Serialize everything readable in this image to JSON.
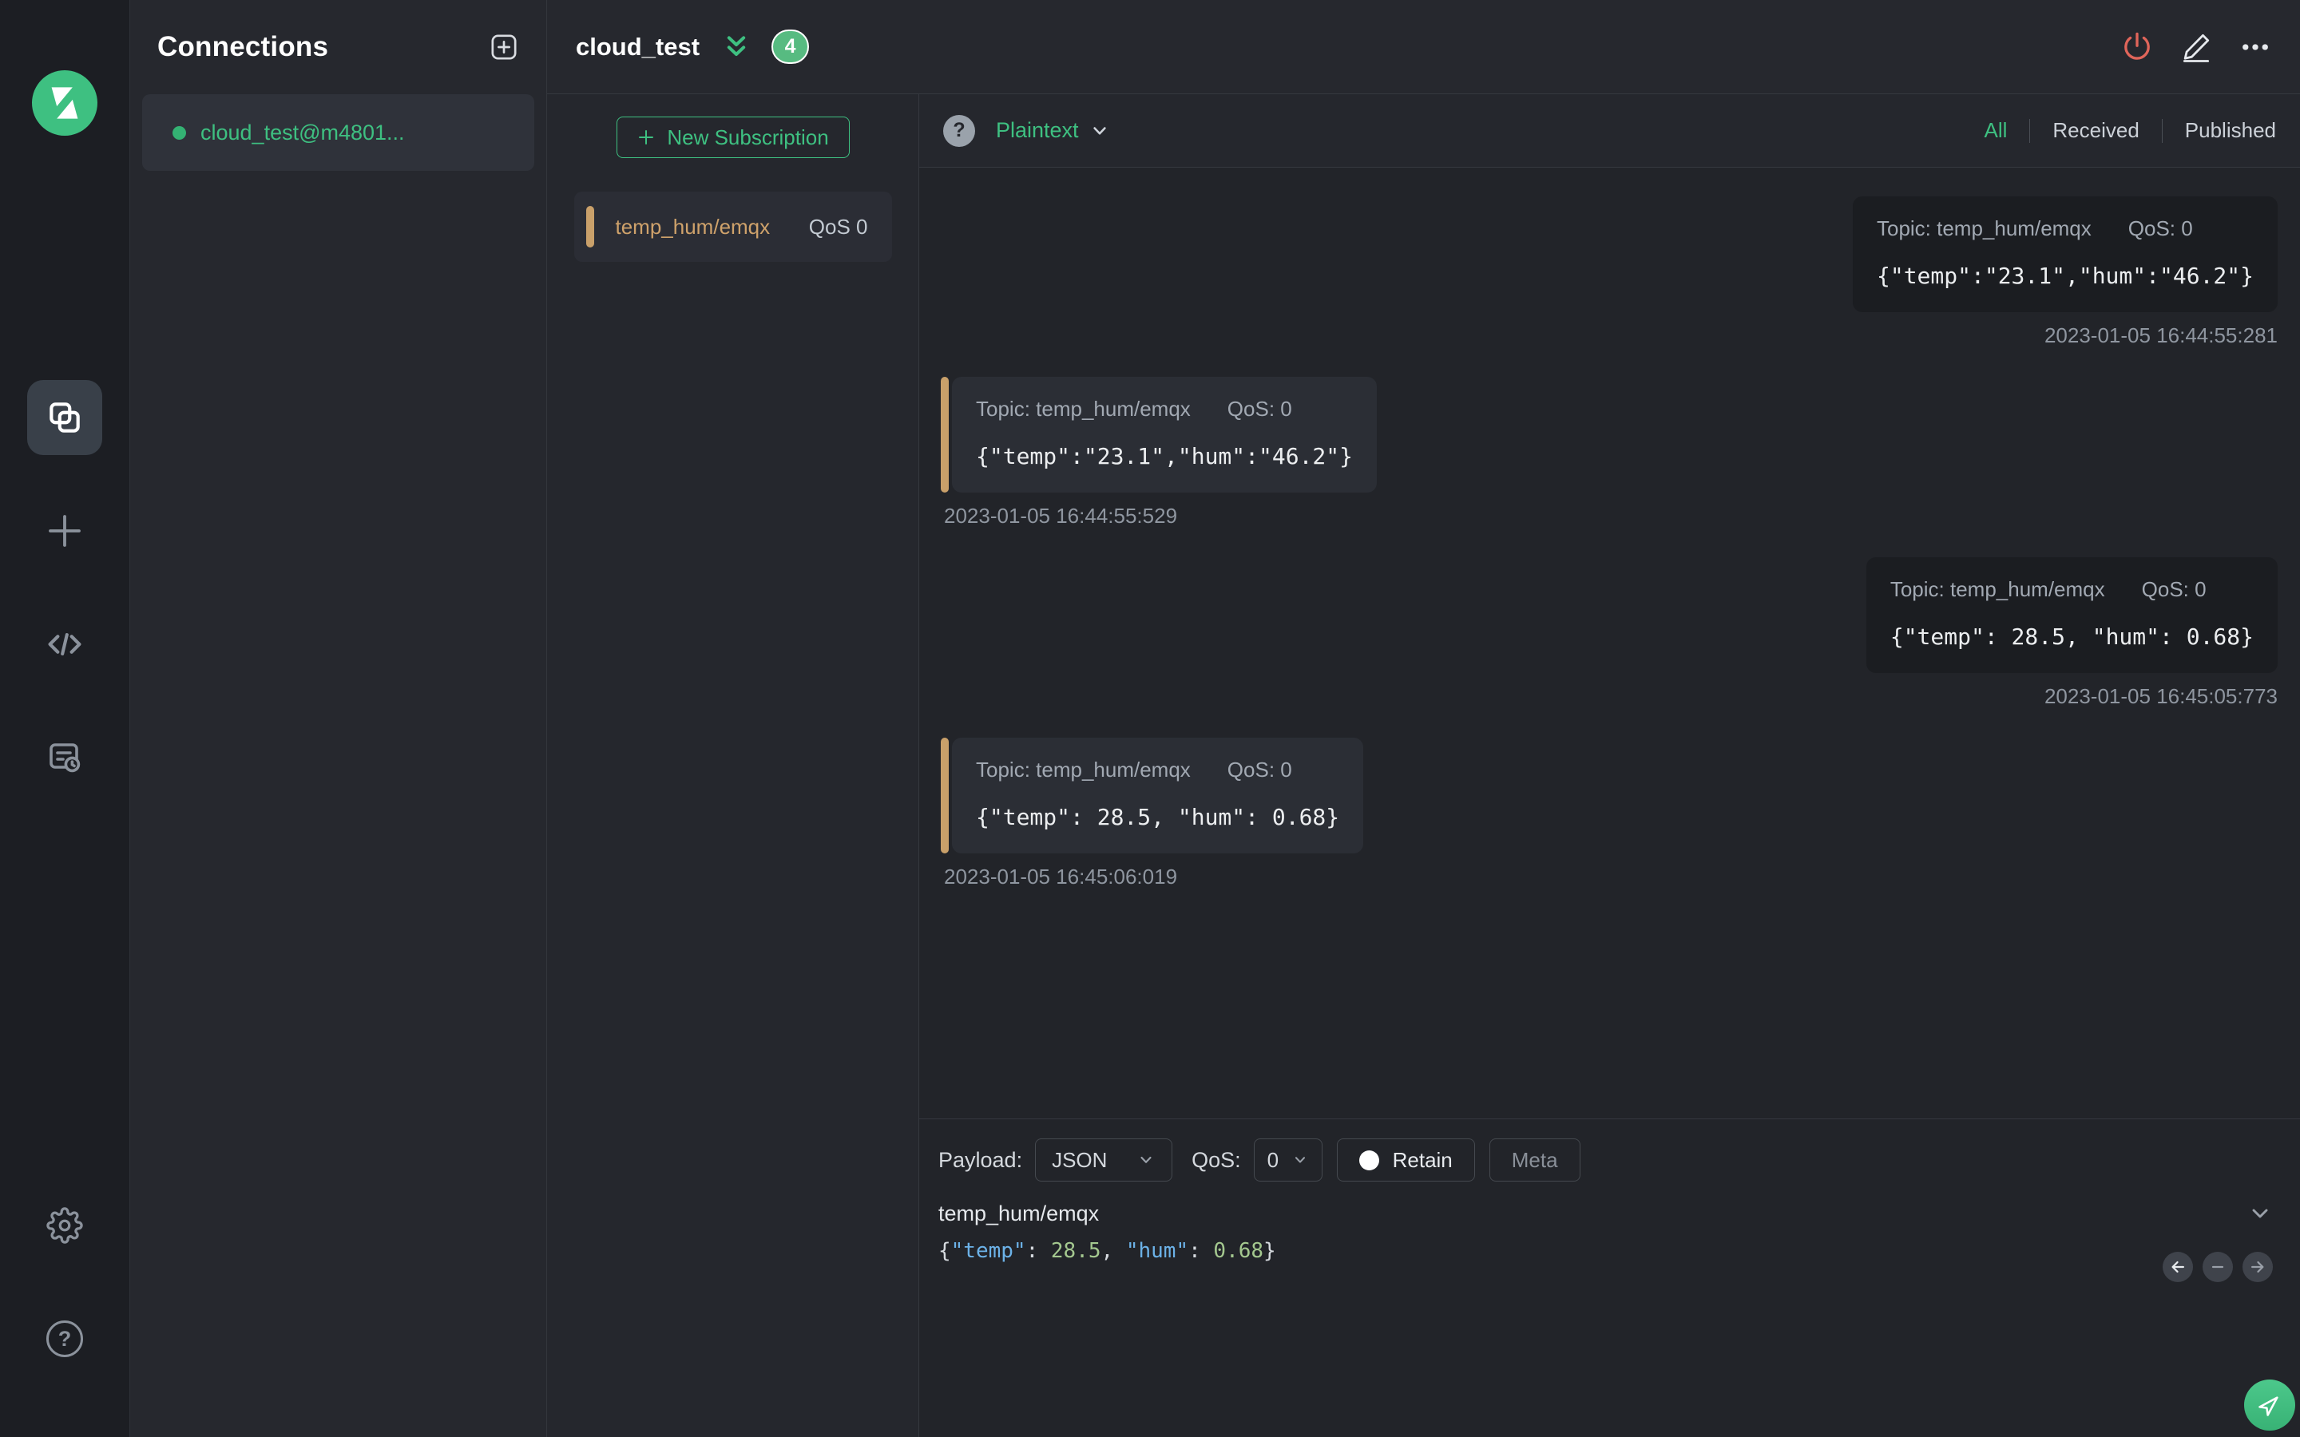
{
  "colors": {
    "accent": "#3ec081",
    "topic_accent": "#c9a06a",
    "power_icon": "#e0655a",
    "badge_bg": "#57bb81",
    "connection_status": "#34b273",
    "syntax_key": "#6cb2e8",
    "syntax_number": "#a4c88f"
  },
  "sidebar": {
    "title": "Connections",
    "connection_name": "cloud_test@m4801..."
  },
  "topbar": {
    "connection_name": "cloud_test",
    "badge_count": "4"
  },
  "subscriptions": {
    "new_button_label": "New Subscription",
    "items": [
      {
        "topic": "temp_hum/emqx",
        "qos": "QoS 0"
      }
    ]
  },
  "messages_header": {
    "help_glyph": "?",
    "format": "Plaintext",
    "tabs": [
      {
        "label": "All",
        "active": true
      },
      {
        "label": "Received",
        "active": false
      },
      {
        "label": "Published",
        "active": false
      }
    ]
  },
  "messages": [
    {
      "direction": "published",
      "topic_label": "Topic: temp_hum/emqx",
      "qos_label": "QoS: 0",
      "payload": "{\"temp\":\"23.1\",\"hum\":\"46.2\"}",
      "timestamp": "2023-01-05 16:44:55:281"
    },
    {
      "direction": "received",
      "topic_label": "Topic: temp_hum/emqx",
      "qos_label": "QoS: 0",
      "payload": "{\"temp\":\"23.1\",\"hum\":\"46.2\"}",
      "timestamp": "2023-01-05 16:44:55:529"
    },
    {
      "direction": "published",
      "topic_label": "Topic: temp_hum/emqx",
      "qos_label": "QoS: 0",
      "payload": "{\"temp\": 28.5, \"hum\": 0.68}",
      "timestamp": "2023-01-05 16:45:05:773"
    },
    {
      "direction": "received",
      "topic_label": "Topic: temp_hum/emqx",
      "qos_label": "QoS: 0",
      "payload": "{\"temp\": 28.5, \"hum\": 0.68}",
      "timestamp": "2023-01-05 16:45:06:019"
    }
  ],
  "publish": {
    "payload_label": "Payload:",
    "payload_format": "JSON",
    "qos_label": "QoS:",
    "qos_value": "0",
    "retain_label": "Retain",
    "meta_label": "Meta",
    "topic_value": "temp_hum/emqx",
    "payload_segments": [
      {
        "text": "{",
        "type": "punct"
      },
      {
        "text": "\"temp\"",
        "type": "key"
      },
      {
        "text": ": ",
        "type": "punct"
      },
      {
        "text": "28.5",
        "type": "number"
      },
      {
        "text": ", ",
        "type": "punct"
      },
      {
        "text": "\"hum\"",
        "type": "key"
      },
      {
        "text": ": ",
        "type": "punct"
      },
      {
        "text": "0.68",
        "type": "number"
      },
      {
        "text": "}",
        "type": "punct"
      }
    ]
  }
}
